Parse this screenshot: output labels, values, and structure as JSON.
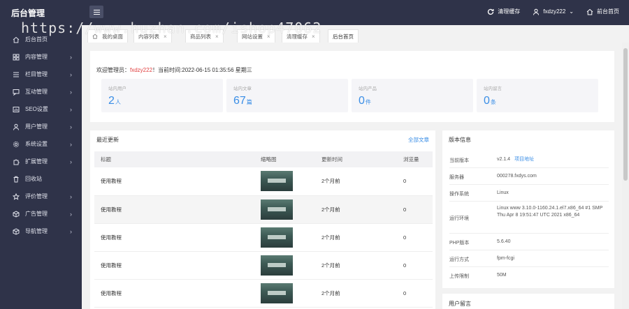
{
  "header": {
    "logo": "后台管理",
    "clear_cache": "清理缓存",
    "username": "fxdzy222",
    "home": "前台首页"
  },
  "watermark": "https://www.huzhan.com/ishop47062",
  "sidebar": {
    "items": [
      {
        "label": "后台首页",
        "icon": "home-icon",
        "arrow": false
      },
      {
        "label": "内容管理",
        "icon": "grid-icon",
        "arrow": true
      },
      {
        "label": "栏目管理",
        "icon": "list-icon",
        "arrow": true
      },
      {
        "label": "互动管理",
        "icon": "chat-icon",
        "arrow": true
      },
      {
        "label": "SEO设置",
        "icon": "chart-icon",
        "arrow": true
      },
      {
        "label": "用户管理",
        "icon": "user-icon",
        "arrow": true
      },
      {
        "label": "系统设置",
        "icon": "gear-icon",
        "arrow": true
      },
      {
        "label": "扩展管理",
        "icon": "puzzle-icon",
        "arrow": true
      },
      {
        "label": "回收站",
        "icon": "trash-icon",
        "arrow": false
      },
      {
        "label": "评价管理",
        "icon": "star-icon",
        "arrow": true
      },
      {
        "label": "广告管理",
        "icon": "cube-icon",
        "arrow": true
      },
      {
        "label": "导航管理",
        "icon": "nav-icon",
        "arrow": true
      }
    ]
  },
  "tabs": [
    {
      "label": "我的桌面"
    },
    {
      "label": "内容列表"
    },
    {
      "label": "商品列表"
    },
    {
      "label": "网站设置"
    },
    {
      "label": "清理缓存"
    },
    {
      "label": "后台首页"
    }
  ],
  "welcome": {
    "prefix": "欢迎管理员：",
    "user": "fxdzy222",
    "suffix": "！当前时间:2022-06-15 01:35:56 星期三"
  },
  "stats": [
    {
      "label": "站内用户",
      "value": "2",
      "unit": "人"
    },
    {
      "label": "站内文章",
      "value": "67",
      "unit": "篇"
    },
    {
      "label": "站内产品",
      "value": "0",
      "unit": "件"
    },
    {
      "label": "站内留言",
      "value": "0",
      "unit": "条"
    }
  ],
  "recent": {
    "title": "最近更新",
    "more": "全部文章",
    "headers": [
      "标题",
      "缩略图",
      "更新时间",
      "浏览量"
    ],
    "rows": [
      {
        "title": "使用教程",
        "time": "2个月前",
        "views": "0"
      },
      {
        "title": "使用教程",
        "time": "2个月前",
        "views": "0"
      },
      {
        "title": "使用教程",
        "time": "2个月前",
        "views": "0"
      },
      {
        "title": "使用教程",
        "time": "2个月前",
        "views": "0"
      },
      {
        "title": "使用教程",
        "time": "2个月前",
        "views": "0"
      }
    ]
  },
  "version": {
    "title": "版本信息",
    "rows": [
      {
        "key": "当前版本",
        "value": "v2.1.4",
        "link": "项目地址"
      },
      {
        "key": "服务器",
        "value": "000278.fxdys.com"
      },
      {
        "key": "操作系统",
        "value": "Linux"
      },
      {
        "key": "运行环境",
        "value": "Linux www 3.10.0-1160.24.1.el7.x86_64 #1 SMP Thu Apr 8 19:51:47 UTC 2021 x86_64"
      },
      {
        "key": "PHP版本",
        "value": "5.6.40"
      },
      {
        "key": "运行方式",
        "value": "fpm-fcgi"
      },
      {
        "key": "上传限制",
        "value": "50M"
      }
    ]
  },
  "messages": {
    "title": "用户留言"
  }
}
